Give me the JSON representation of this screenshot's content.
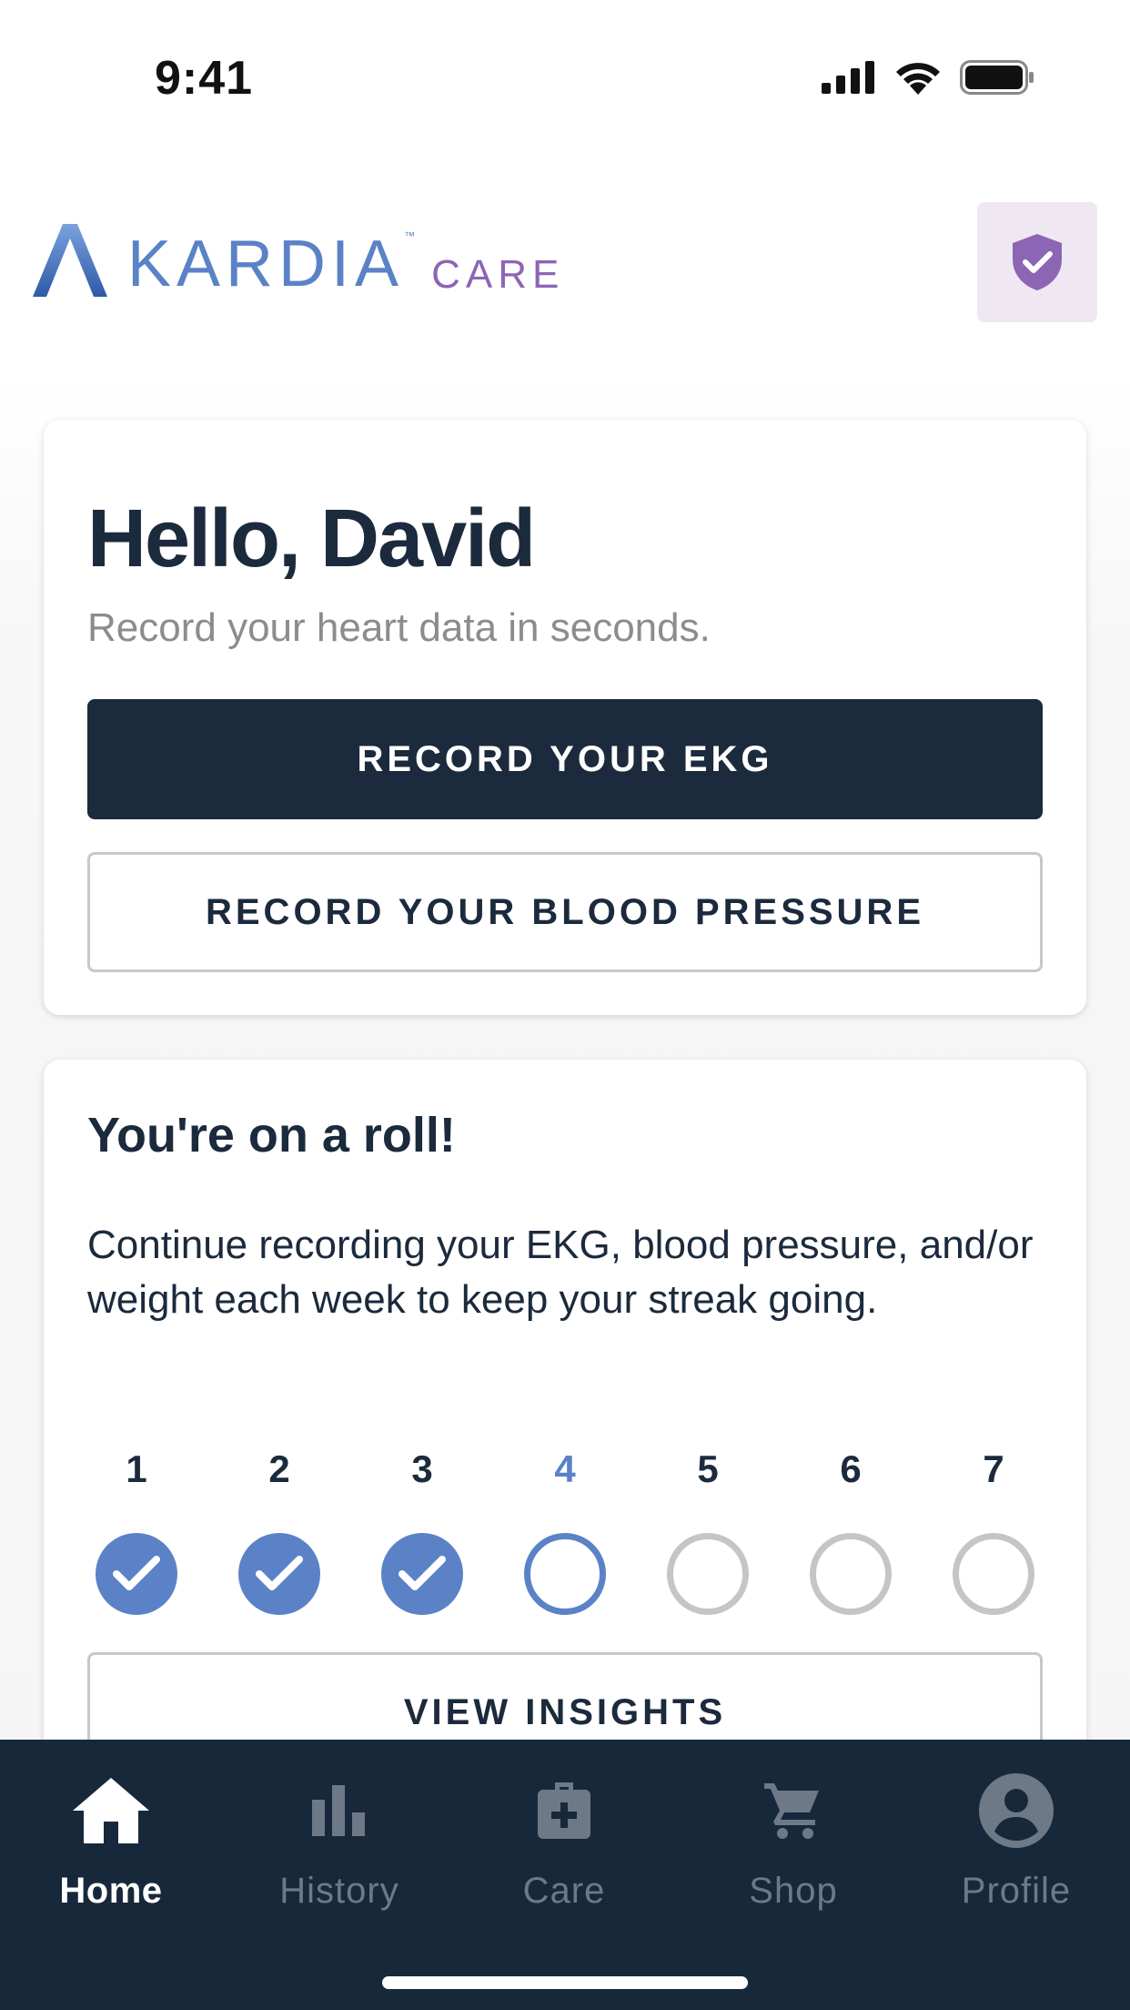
{
  "status_bar": {
    "time": "9:41",
    "icons": [
      "cellular-signal-icon",
      "wifi-icon",
      "battery-icon"
    ]
  },
  "header": {
    "logo_word": "KARDIA",
    "logo_trademark": "™",
    "logo_suffix": "CARE",
    "shield_icon": "shield-check-icon"
  },
  "hello_card": {
    "title": "Hello, David",
    "subtitle": "Record your heart data in seconds.",
    "record_ekg_label": "RECORD YOUR EKG",
    "record_bp_label": "RECORD YOUR BLOOD PRESSURE"
  },
  "streak_card": {
    "title": "You're on a roll!",
    "description": "Continue recording your EKG, blood pressure, and/or weight each week to keep your streak going.",
    "days": [
      {
        "label": "1",
        "state": "done"
      },
      {
        "label": "2",
        "state": "done"
      },
      {
        "label": "3",
        "state": "done"
      },
      {
        "label": "4",
        "state": "current"
      },
      {
        "label": "5",
        "state": "todo"
      },
      {
        "label": "6",
        "state": "todo"
      },
      {
        "label": "7",
        "state": "todo"
      }
    ],
    "view_insights_label": "VIEW INSIGHTS"
  },
  "bottom_nav": {
    "items": [
      {
        "label": "Home",
        "icon": "home-icon",
        "active": true
      },
      {
        "label": "History",
        "icon": "bar-chart-icon",
        "active": false
      },
      {
        "label": "Care",
        "icon": "medical-kit-icon",
        "active": false
      },
      {
        "label": "Shop",
        "icon": "shopping-cart-icon",
        "active": false
      },
      {
        "label": "Profile",
        "icon": "account-circle-icon",
        "active": false
      }
    ]
  },
  "colors": {
    "navy": "#1b2a3c",
    "nav_background": "#17283b",
    "accent_blue": "#5b82c6",
    "brand_purple": "#8d65b5",
    "shield_bg": "#efe8f3",
    "muted_gray": "#8c8c8c",
    "inactive_nav": "#6d7987"
  }
}
